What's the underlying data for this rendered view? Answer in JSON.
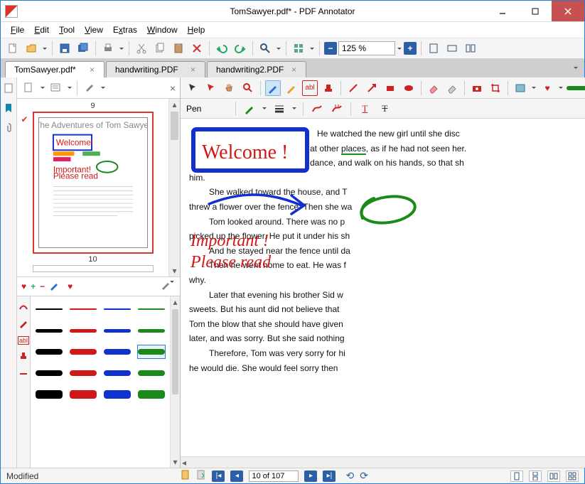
{
  "window": {
    "title": "TomSawyer.pdf* - PDF Annotator"
  },
  "menu": {
    "file": "File",
    "edit": "Edit",
    "tool": "Tool",
    "view": "View",
    "extras": "Extras",
    "window": "Window",
    "help": "Help"
  },
  "toolbar": {
    "zoom_value": "125 %"
  },
  "tabs": [
    {
      "label": "TomSawyer.pdf*",
      "active": true
    },
    {
      "label": "handwriting.PDF",
      "active": false
    },
    {
      "label": "handwriting2.PDF",
      "active": false
    }
  ],
  "side": {
    "page_above": "9",
    "page_below": "10"
  },
  "annotate_row2": {
    "tool_label": "Pen"
  },
  "annotations": {
    "welcome": "Welcome !",
    "important_l1": "Important !",
    "important_l2": "Please read"
  },
  "doc": {
    "p1": "He watched the new girl until she disc",
    "p1b": "at other places, as if he had not seen her.",
    "p1c": "dance, and walk on his hands, so that sh",
    "p1d": "him.",
    "p2": "She walked toward the house, and T",
    "p2b": "threw a flower over the fence. Then she wa",
    "p3": "Tom looked around. There was no p",
    "p3b": "picked up the flower. He put it under his sh",
    "p4": "And he stayed near the fence until da",
    "p4b": "Then he went home to eat. He was f",
    "p4c": "why.",
    "p5": "Later that evening his brother Sid w",
    "p5b": "sweets. But his aunt did not believe that",
    "p5c": "Tom the blow that she should have given",
    "p5d": "later, and was sorry. But she said nothing",
    "p6": "Therefore, Tom was very sorry for hi",
    "p6b": "he would die. She would feel sorry then"
  },
  "status": {
    "modified": "Modified",
    "page_field": "10 of 107"
  },
  "colors": {
    "black": "#000000",
    "red": "#d01818",
    "blue": "#1030d0",
    "green": "#1a8a1a",
    "accent": "#2d5fa4",
    "tab_border": "#9a9a9a",
    "sel_red": "#d33"
  },
  "swatches": [
    {
      "w": "thin",
      "c": "black"
    },
    {
      "w": "thin",
      "c": "red"
    },
    {
      "w": "thin",
      "c": "blue"
    },
    {
      "w": "thin",
      "c": "green"
    },
    {
      "w": "med",
      "c": "black"
    },
    {
      "w": "med",
      "c": "red"
    },
    {
      "w": "med",
      "c": "blue"
    },
    {
      "w": "med",
      "c": "green"
    },
    {
      "w": "",
      "c": "black"
    },
    {
      "w": "",
      "c": "red"
    },
    {
      "w": "",
      "c": "blue"
    },
    {
      "w": "",
      "c": "green",
      "sel": true
    },
    {
      "w": "",
      "c": "black"
    },
    {
      "w": "",
      "c": "red"
    },
    {
      "w": "",
      "c": "blue"
    },
    {
      "w": "",
      "c": "green"
    },
    {
      "w": "",
      "c": "black",
      "big": true
    },
    {
      "w": "",
      "c": "red",
      "big": true
    },
    {
      "w": "",
      "c": "blue",
      "big": true
    },
    {
      "w": "",
      "c": "green",
      "big": true
    }
  ]
}
